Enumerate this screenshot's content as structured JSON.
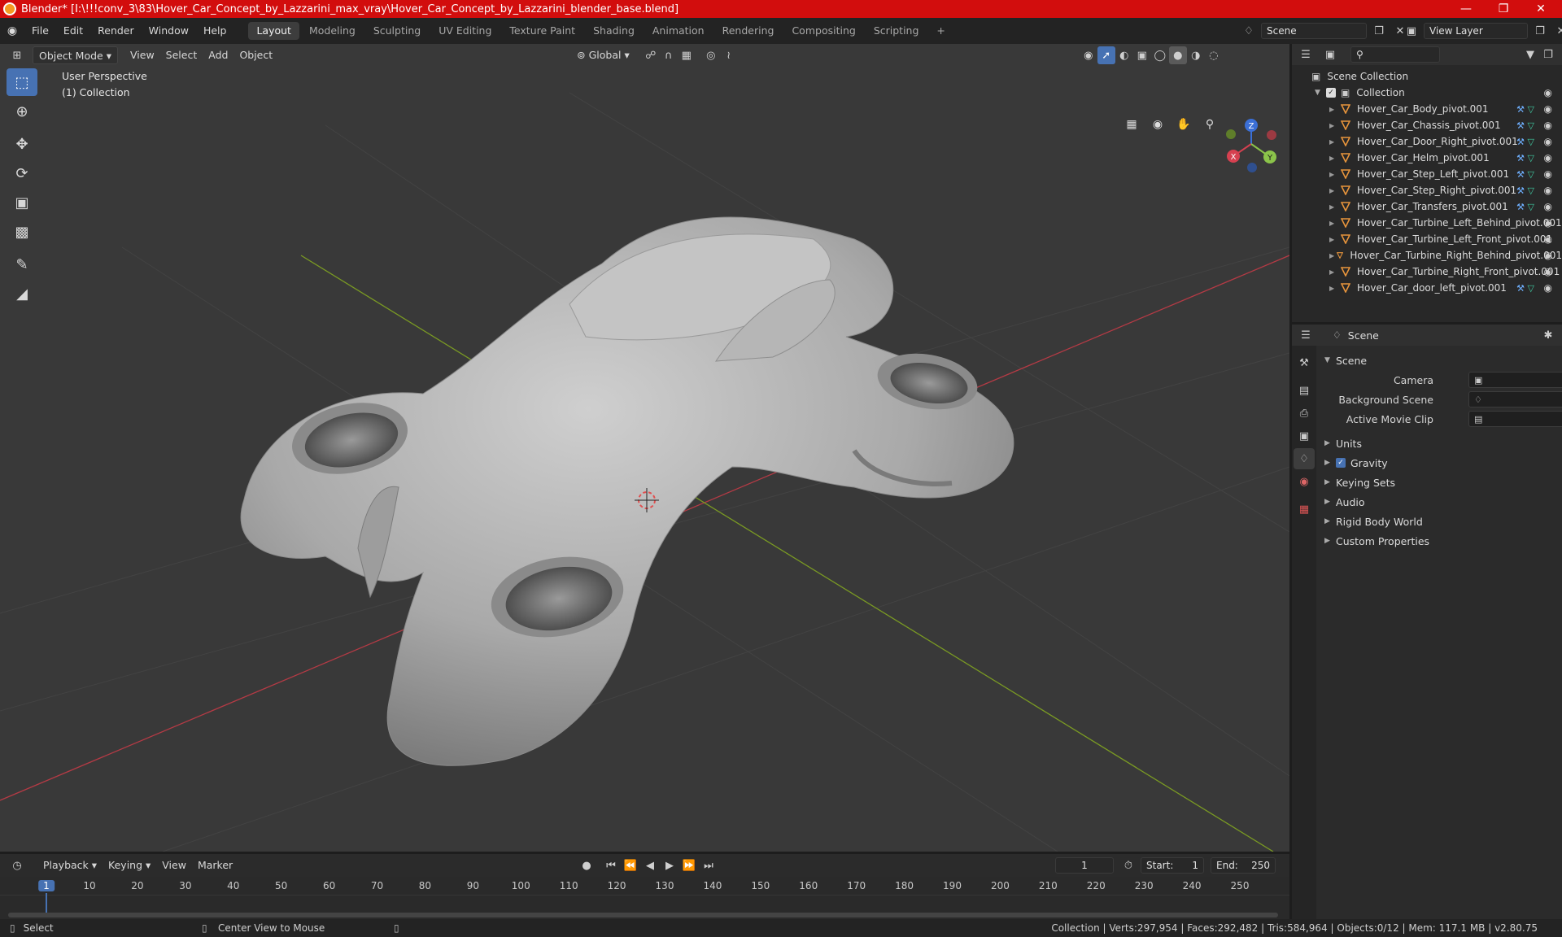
{
  "window": {
    "title": "Blender* [I:\\!!!conv_3\\83\\Hover_Car_Concept_by_Lazzarini_max_vray\\Hover_Car_Concept_by_Lazzarini_blender_base.blend]",
    "title_color": "#d20d0d"
  },
  "menu": {
    "items": [
      "File",
      "Edit",
      "Render",
      "Window",
      "Help"
    ]
  },
  "workspaces": {
    "tabs": [
      "Layout",
      "Modeling",
      "Sculpting",
      "UV Editing",
      "Texture Paint",
      "Shading",
      "Animation",
      "Rendering",
      "Compositing",
      "Scripting"
    ],
    "active": "Layout",
    "add": "+"
  },
  "scene_selector": {
    "value": "Scene"
  },
  "view_layer_selector": {
    "value": "View Layer"
  },
  "viewport": {
    "mode": "Object Mode",
    "menus": [
      "View",
      "Select",
      "Add",
      "Object"
    ],
    "orientation": "Global",
    "perspective_label": "User Perspective",
    "collection_label": "(1) Collection",
    "gizmo": {
      "x": "X",
      "y": "Y",
      "z": "Z"
    },
    "background": "#393939",
    "accent": "#4772b3"
  },
  "outliner": {
    "root": "Scene Collection",
    "collection": "Collection",
    "objects": [
      "Hover_Car_Body_pivot.001",
      "Hover_Car_Chassis_pivot.001",
      "Hover_Car_Door_Right_pivot.001",
      "Hover_Car_Helm_pivot.001",
      "Hover_Car_Step_Left_pivot.001",
      "Hover_Car_Step_Right_pivot.001",
      "Hover_Car_Transfers_pivot.001",
      "Hover_Car_Turbine_Left_Behind_pivot.001",
      "Hover_Car_Turbine_Left_Front_pivot.001",
      "Hover_Car_Turbine_Right_Behind_pivot.001",
      "Hover_Car_Turbine_Right_Front_pivot.001",
      "Hover_Car_door_left_pivot.001"
    ],
    "with_modifiers": [
      true,
      true,
      true,
      true,
      true,
      true,
      true,
      false,
      false,
      false,
      false,
      true
    ]
  },
  "properties": {
    "context": "Scene",
    "panel": "Scene",
    "fields": [
      {
        "label": "Camera"
      },
      {
        "label": "Background Scene"
      },
      {
        "label": "Active Movie Clip"
      }
    ],
    "subpanels": [
      "Units",
      "Gravity",
      "Keying Sets",
      "Audio",
      "Rigid Body World",
      "Custom Properties"
    ],
    "gravity_checked": true
  },
  "timeline": {
    "menus": [
      "Playback",
      "Keying",
      "View",
      "Marker"
    ],
    "current_frame": "1",
    "start_label": "Start:",
    "start": "1",
    "end_label": "End:",
    "end": "250",
    "ticks": [
      "1",
      "10",
      "20",
      "30",
      "40",
      "50",
      "60",
      "70",
      "80",
      "90",
      "100",
      "110",
      "120",
      "130",
      "140",
      "150",
      "160",
      "170",
      "180",
      "190",
      "200",
      "210",
      "220",
      "230",
      "240",
      "250"
    ]
  },
  "statusbar": {
    "left": "Select",
    "middle": "Center View to Mouse",
    "stats": "Collection | Verts:297,954 | Faces:292,482 | Tris:584,964 | Objects:0/12 | Mem: 117.1 MB | v2.80.75"
  }
}
